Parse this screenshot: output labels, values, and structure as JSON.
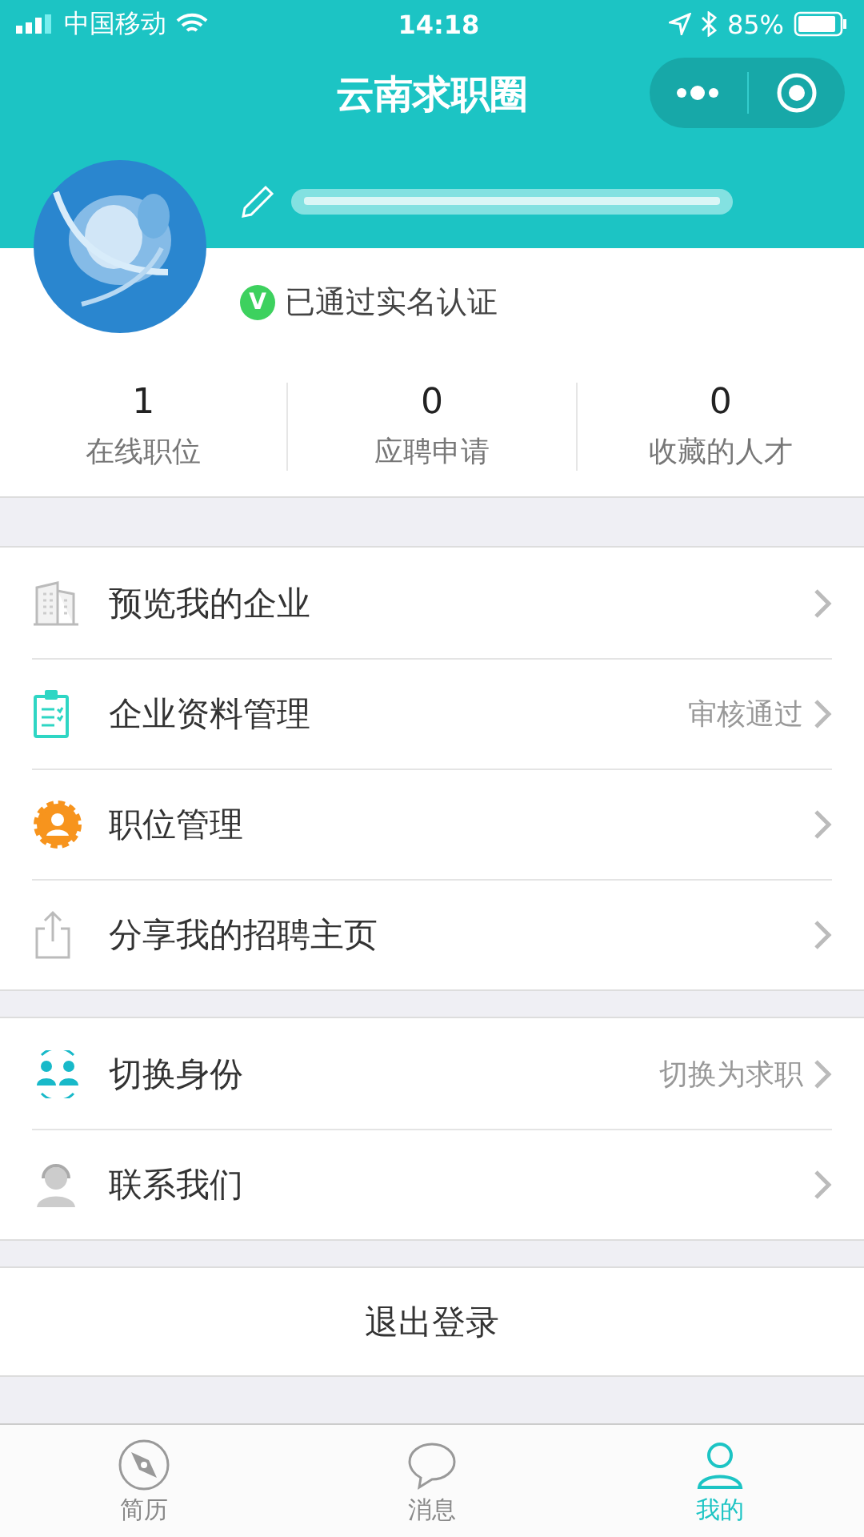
{
  "status_bar": {
    "carrier": "中国移动",
    "time": "14:18",
    "battery": "85%"
  },
  "nav": {
    "title": "云南求职圈"
  },
  "profile": {
    "verified": "已通过实名认证",
    "verified_badge": "V"
  },
  "stats": [
    {
      "value": "1",
      "label": "在线职位"
    },
    {
      "value": "0",
      "label": "应聘申请"
    },
    {
      "value": "0",
      "label": "收藏的人才"
    }
  ],
  "menu_groups": [
    [
      {
        "kind": "building",
        "label": "预览我的企业"
      },
      {
        "kind": "clipboard",
        "label": "企业资料管理",
        "note": "审核通过"
      },
      {
        "kind": "gear",
        "label": "职位管理"
      },
      {
        "kind": "share",
        "label": "分享我的招聘主页"
      }
    ],
    [
      {
        "kind": "switch",
        "label": "切换身份",
        "note": "切换为求职"
      },
      {
        "kind": "contact",
        "label": "联系我们"
      }
    ]
  ],
  "logout": "退出登录",
  "tabs": [
    {
      "kind": "compass",
      "label": "简历",
      "selected": false
    },
    {
      "kind": "chat",
      "label": "消息",
      "selected": false
    },
    {
      "kind": "person",
      "label": "我的",
      "selected": true
    }
  ]
}
